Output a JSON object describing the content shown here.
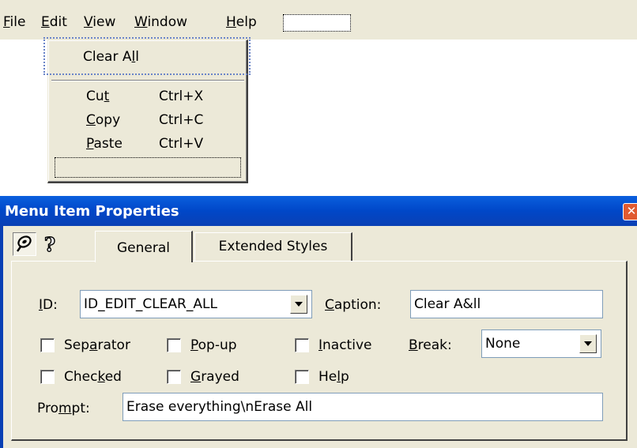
{
  "menubar": {
    "items": [
      {
        "label": "File",
        "mnemonic": "F",
        "rest": "ile"
      },
      {
        "label": "Edit",
        "mnemonic": "E",
        "rest": "dit"
      },
      {
        "label": "View",
        "mnemonic": "V",
        "rest": "iew"
      },
      {
        "label": "Window",
        "mnemonic": "W",
        "rest": "indow"
      },
      {
        "label": "Help",
        "mnemonic": "H",
        "rest": "elp"
      }
    ]
  },
  "edit_menu": {
    "clear_all": {
      "pre": "Clear A",
      "mnemonic": "l",
      "post": "l"
    },
    "items": [
      {
        "pre": "Cu",
        "mnemonic": "t",
        "post": "",
        "shortcut": "Ctrl+X"
      },
      {
        "pre": "",
        "mnemonic": "C",
        "post": "opy",
        "shortcut": "Ctrl+C"
      },
      {
        "pre": "",
        "mnemonic": "P",
        "post": "aste",
        "shortcut": "Ctrl+V"
      }
    ]
  },
  "dialog": {
    "title": "Menu Item Properties",
    "close_glyph": "✕",
    "help_glyph": "?",
    "tabs": [
      {
        "label": "General",
        "active": true
      },
      {
        "label": "Extended Styles",
        "active": false
      }
    ],
    "id_label": {
      "pre": "",
      "mnemonic": "I",
      "post": "D:"
    },
    "id_value": "ID_EDIT_CLEAR_ALL",
    "caption_label": {
      "pre": "",
      "mnemonic": "C",
      "post": "aption:"
    },
    "caption_value": "Clear A&ll",
    "checkboxes": [
      {
        "pre": "Sep",
        "mnemonic": "a",
        "post": "rator",
        "checked": false
      },
      {
        "pre": "",
        "mnemonic": "P",
        "post": "op-up",
        "checked": false
      },
      {
        "pre": "",
        "mnemonic": "I",
        "post": "nactive",
        "checked": false
      },
      {
        "pre": "Chec",
        "mnemonic": "k",
        "post": "ed",
        "checked": false
      },
      {
        "pre": "",
        "mnemonic": "G",
        "post": "rayed",
        "checked": false
      },
      {
        "pre": "He",
        "mnemonic": "l",
        "post": "p",
        "checked": false
      }
    ],
    "break_label": {
      "pre": "",
      "mnemonic": "B",
      "post": "reak:"
    },
    "break_value": "None",
    "prompt_label": {
      "pre": "Pro",
      "mnemonic": "m",
      "post": "pt:"
    },
    "prompt_value": "Erase everything\\nErase All"
  }
}
